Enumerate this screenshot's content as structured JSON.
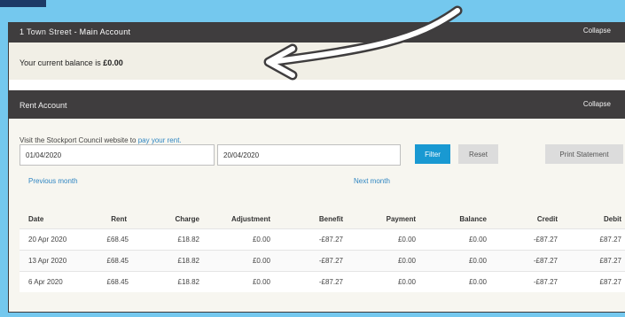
{
  "main_account": {
    "title": "1 Town Street",
    "subtitle": "- Main Account",
    "collapse_label": "Collapse",
    "balance_prefix": "Your current balance is",
    "balance_value": "£0.00"
  },
  "rent_account": {
    "title": "Rent Account",
    "collapse_label": "Collapse",
    "visit_text": "Visit the Stockport Council website to",
    "visit_link": "pay your rent.",
    "from_date": "01/04/2020",
    "to_date": "20/04/2020",
    "filter_label": "Filter",
    "reset_label": "Reset",
    "print_label": "Print Statement",
    "prev_month_label": "Previous month",
    "next_month_label": "Next month"
  },
  "table": {
    "columns": [
      "Date",
      "Rent",
      "Charge",
      "Adjustment",
      "Benefit",
      "Payment",
      "Balance",
      "Credit",
      "Debit"
    ],
    "rows": [
      [
        "20 Apr 2020",
        "£68.45",
        "£18.82",
        "£0.00",
        "-£87.27",
        "£0.00",
        "£0.00",
        "-£87.27",
        "£87.27"
      ],
      [
        "13 Apr 2020",
        "£68.45",
        "£18.82",
        "£0.00",
        "-£87.27",
        "£0.00",
        "£0.00",
        "-£87.27",
        "£87.27"
      ],
      [
        "6 Apr 2020",
        "£68.45",
        "£18.82",
        "£0.00",
        "-£87.27",
        "£0.00",
        "£0.00",
        "-£87.27",
        "£87.27"
      ]
    ]
  },
  "icons": {
    "annotation": "curved-arrow-icon"
  },
  "colors": {
    "background": "#74c8ee",
    "header": "#3f3d3e",
    "accent": "#1999d2",
    "link": "#2f86c2"
  }
}
